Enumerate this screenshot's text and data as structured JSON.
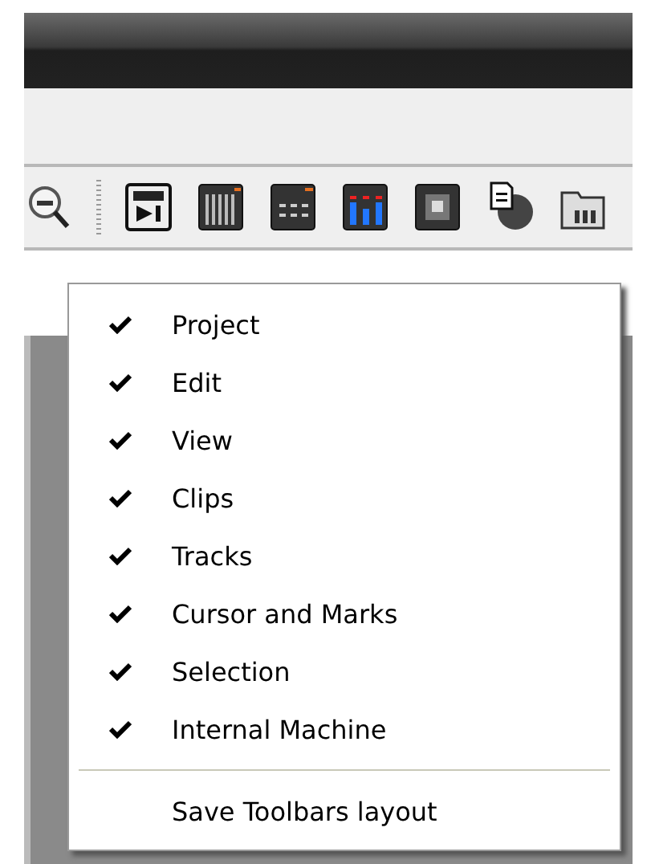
{
  "menu": {
    "items": [
      {
        "kind": "check",
        "label": "Project",
        "checked": true
      },
      {
        "kind": "check",
        "label": "Edit",
        "checked": true
      },
      {
        "kind": "check",
        "label": "View",
        "checked": true
      },
      {
        "kind": "check",
        "label": "Clips",
        "checked": true
      },
      {
        "kind": "check",
        "label": "Tracks",
        "checked": true
      },
      {
        "kind": "check",
        "label": "Cursor and Marks",
        "checked": true
      },
      {
        "kind": "check",
        "label": "Selection",
        "checked": true
      },
      {
        "kind": "check",
        "label": "Internal Machine",
        "checked": true
      },
      {
        "kind": "separator"
      },
      {
        "kind": "action",
        "label": "Save Toolbars layout"
      }
    ]
  }
}
